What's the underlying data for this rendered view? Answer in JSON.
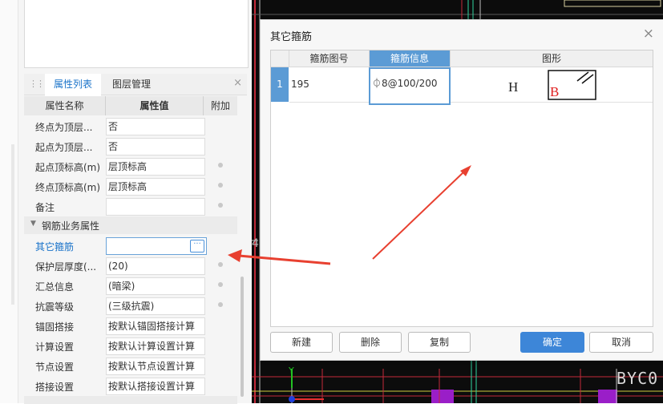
{
  "panel": {
    "tabs": [
      "属性列表",
      "图层管理"
    ],
    "close_glyph": "×",
    "columns": [
      "属性名称",
      "属性值",
      "附加"
    ],
    "rows": [
      {
        "name": "终点为顶层...",
        "value": "否",
        "dot": false
      },
      {
        "name": "起点为顶层...",
        "value": "否",
        "dot": false
      },
      {
        "name": "起点顶标高(m)",
        "value": "层顶标高",
        "dot": true
      },
      {
        "name": "终点顶标高(m)",
        "value": "层顶标高",
        "dot": true
      },
      {
        "name": "备注",
        "value": "",
        "dot": true
      }
    ],
    "group": "钢筋业务属性",
    "group_rows": [
      {
        "name": "其它箍筋",
        "value": "",
        "dot": false
      },
      {
        "name": "保护层厚度(...",
        "value": "(20)",
        "dot": true
      },
      {
        "name": "汇总信息",
        "value": "(暗梁)",
        "dot": true
      },
      {
        "name": "抗震等级",
        "value": "(三级抗震)",
        "dot": true
      },
      {
        "name": "锚固搭接",
        "value": "按默认锚固搭接计算",
        "dot": false
      },
      {
        "name": "计算设置",
        "value": "按默认计算设置计算",
        "dot": false
      },
      {
        "name": "节点设置",
        "value": "按默认节点设置计算",
        "dot": false
      },
      {
        "name": "搭接设置",
        "value": "按默认搭接设置计算",
        "dot": false
      }
    ],
    "ellipsis": "···"
  },
  "dialog": {
    "title": "其它箍筋",
    "close_glyph": "×",
    "columns": [
      "箍筋图号",
      "箍筋信息",
      "图形"
    ],
    "row": {
      "index": "1",
      "shape_no": "195",
      "info": "⏀8@100/200"
    },
    "shape_labels": {
      "h": "H",
      "b": "B"
    },
    "buttons": {
      "new": "新建",
      "delete": "删除",
      "copy": "复制",
      "ok": "确定",
      "cancel": "取消"
    }
  },
  "cad": {
    "text": "BYC0",
    "axis_y": "Y",
    "axis_marker": "4"
  },
  "colors": {
    "accent": "#3d86d8",
    "link": "#1a73c9",
    "arrow": "#e84030",
    "selected_header": "#5b9bd5"
  }
}
